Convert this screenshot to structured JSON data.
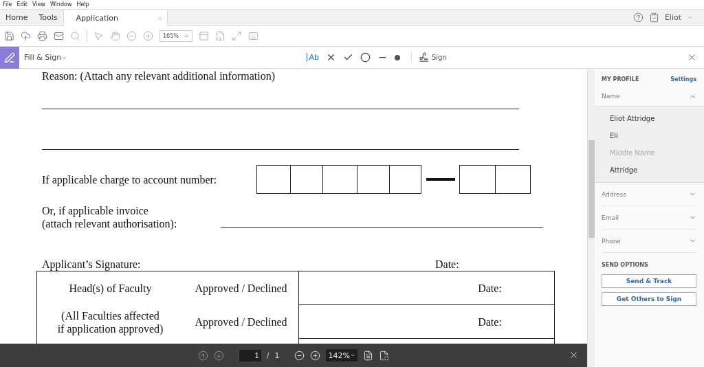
{
  "menu_bar": [
    "File",
    "Edit",
    "View",
    "Window",
    "Help"
  ],
  "tabs": [
    {
      "label": "Home",
      "selected": false
    },
    {
      "label": "Tools",
      "selected": false
    },
    {
      "label": "Application",
      "selected": true
    }
  ],
  "account": {
    "user": "Eliot"
  },
  "toolbar": {
    "zoom": "165%"
  },
  "fill_sign": {
    "title": "Fill & Sign",
    "text_tool": "Ab",
    "sign": "Sign"
  },
  "document": {
    "reason_label": "Reason: (Attach any relevant additional information)",
    "account_label": "If applicable charge to account number:",
    "invoice_label": [
      "Or, if applicable invoice",
      "(attach relevant authorisation):"
    ],
    "signature_label": "Applicant’s Signature:",
    "signature_date": "Date:",
    "approval_rows": [
      {
        "role": [
          "Head(s) of Faculty"
        ],
        "status": "Approved / Declined",
        "date": "Date:"
      },
      {
        "role": [
          "(All Faculties affected",
          "if application approved)"
        ],
        "status": "Approved / Declined",
        "date": "Date:"
      }
    ]
  },
  "page_nav": {
    "page": "1",
    "separator": "/",
    "total": "1",
    "zoom": "142%"
  },
  "profile_panel": {
    "heading": "MY PROFILE",
    "settings": "Settings",
    "sections": [
      {
        "label": "Name",
        "expanded": true,
        "fields": [
          {
            "value": "Eliot Attridge"
          },
          {
            "value": "Eli"
          },
          {
            "placeholder": "Middle Name"
          },
          {
            "value": "Attridge"
          }
        ]
      },
      {
        "label": "Address",
        "expanded": false
      },
      {
        "label": "Email",
        "expanded": false
      },
      {
        "label": "Phone",
        "expanded": false
      }
    ],
    "send_heading": "SEND OPTIONS",
    "buttons": [
      "Send & Track",
      "Get Others to Sign"
    ]
  }
}
